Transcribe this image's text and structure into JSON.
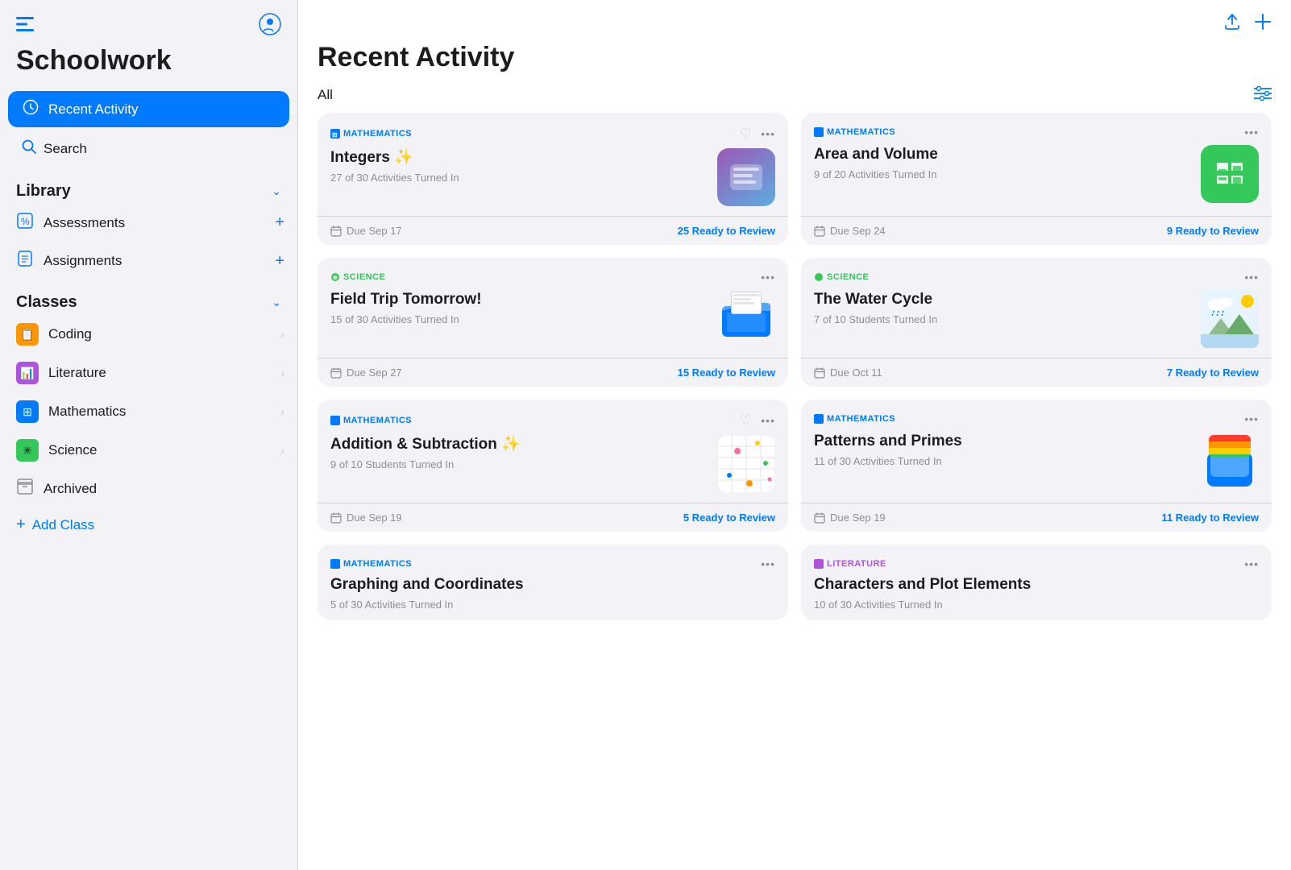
{
  "app": {
    "title": "Schoolwork"
  },
  "sidebar": {
    "nav": [
      {
        "id": "recent-activity",
        "label": "Recent Activity",
        "icon": "clock",
        "active": true
      },
      {
        "id": "search",
        "label": "Search",
        "icon": "search",
        "active": false
      }
    ],
    "library": {
      "title": "Library",
      "items": [
        {
          "id": "assessments",
          "label": "Assessments",
          "icon": "%"
        },
        {
          "id": "assignments",
          "label": "Assignments",
          "icon": "doc"
        }
      ]
    },
    "classes": {
      "title": "Classes",
      "items": [
        {
          "id": "coding",
          "label": "Coding",
          "color": "orange"
        },
        {
          "id": "literature",
          "label": "Literature",
          "color": "purple"
        },
        {
          "id": "mathematics",
          "label": "Mathematics",
          "color": "blue"
        },
        {
          "id": "science",
          "label": "Science",
          "color": "green"
        }
      ]
    },
    "archived_label": "Archived",
    "add_class_label": "Add Class"
  },
  "main": {
    "title": "Recent Activity",
    "filter_label": "All",
    "cards": [
      {
        "subject": "MATHEMATICS",
        "subject_type": "math",
        "title": "Integers ✨",
        "subtitle": "27 of 30 Activities Turned In",
        "due": "Due Sep 17",
        "review": "25 Ready to Review",
        "thumb_type": "integers"
      },
      {
        "subject": "MATHEMATICS",
        "subject_type": "math",
        "title": "Area and Volume",
        "subtitle": "9 of 20 Activities Turned In",
        "due": "Due Sep 24",
        "review": "9 Ready to Review",
        "thumb_type": "numbers"
      },
      {
        "subject": "SCIENCE",
        "subject_type": "science",
        "title": "Field Trip Tomorrow!",
        "subtitle": "15 of 30 Activities Turned In",
        "due": "Due Sep 27",
        "review": "15 Ready to Review",
        "thumb_type": "folder-blue"
      },
      {
        "subject": "SCIENCE",
        "subject_type": "science",
        "title": "The Water Cycle",
        "subtitle": "7 of 10 Students Turned In",
        "due": "Due Oct 11",
        "review": "7 Ready to Review",
        "thumb_type": "watercycle"
      },
      {
        "subject": "MATHEMATICS",
        "subject_type": "math",
        "title": "Addition & Subtraction ✨",
        "subtitle": "9 of 10 Students Turned In",
        "due": "Due Sep 19",
        "review": "5 Ready to Review",
        "thumb_type": "spreadsheet"
      },
      {
        "subject": "MATHEMATICS",
        "subject_type": "math",
        "title": "Patterns and Primes",
        "subtitle": "11 of 30 Activities Turned In",
        "due": "Due Sep 19",
        "review": "11 Ready to Review",
        "thumb_type": "folder-stack"
      },
      {
        "subject": "MATHEMATICS",
        "subject_type": "math",
        "title": "Graphing and Coordinates",
        "subtitle": "5 of 30 Activities Turned In",
        "due": "",
        "review": "",
        "thumb_type": "partial"
      },
      {
        "subject": "LITERATURE",
        "subject_type": "literature",
        "title": "Characters and Plot Elements",
        "subtitle": "10 of 30 Activities Turned In",
        "due": "",
        "review": "",
        "thumb_type": "partial-lit"
      }
    ]
  }
}
